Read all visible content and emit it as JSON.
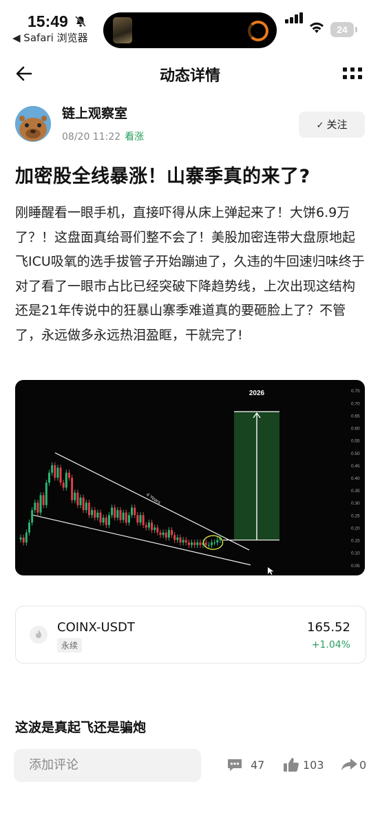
{
  "status_bar": {
    "time": "15:49",
    "back_app": "◀ Safari 浏览器",
    "battery": "24"
  },
  "nav": {
    "title": "动态详情"
  },
  "author": {
    "name": "链上观察室",
    "date": "08/20 11:22",
    "tag": "看涨",
    "follow_label": "关注"
  },
  "post": {
    "title": "加密股全线暴涨！山寨季真的来了?",
    "body": "刚睡醒看一眼手机，直接吓得从床上弹起来了！大饼6.9万了？！这盘面真给哥们整不会了！美股加密连带大盘原地起飞ICU吸氧的选手拔管子开始蹦迪了，久违的牛回速归味终于对了看了一眼市占比已经突破下降趋势线，上次出现这结构还是21年传说中的狂暴山寨季难道真的要砸脸上了？不管了，永远做多永远热泪盈眶，干就完了!"
  },
  "chart_data": {
    "type": "candlestick",
    "annotation_top": "2026",
    "annotation_trend": "4 Years",
    "y_ticks": [
      "0.75",
      "0.70",
      "0.65",
      "0.60",
      "0.55",
      "0.50",
      "0.45",
      "0.40",
      "0.35",
      "0.30",
      "0.25",
      "0.20",
      "0.15",
      "0.10",
      "0.05"
    ],
    "ylim": [
      0.03,
      0.77
    ],
    "projection": {
      "from": 0.15,
      "to": 0.665
    },
    "closes": [
      0.16,
      0.14,
      0.18,
      0.22,
      0.27,
      0.3,
      0.26,
      0.33,
      0.29,
      0.38,
      0.42,
      0.45,
      0.4,
      0.44,
      0.38,
      0.36,
      0.42,
      0.4,
      0.31,
      0.34,
      0.29,
      0.32,
      0.27,
      0.3,
      0.25,
      0.27,
      0.24,
      0.26,
      0.22,
      0.24,
      0.21,
      0.25,
      0.28,
      0.24,
      0.27,
      0.23,
      0.26,
      0.22,
      0.25,
      0.28,
      0.25,
      0.22,
      0.25,
      0.21,
      0.2,
      0.22,
      0.19,
      0.2,
      0.18,
      0.17,
      0.18,
      0.16,
      0.19,
      0.17,
      0.15,
      0.16,
      0.14,
      0.15,
      0.14,
      0.13,
      0.14,
      0.13,
      0.14,
      0.13,
      0.14,
      0.13,
      0.13,
      0.14,
      0.14,
      0.15,
      0.16
    ],
    "colors": {
      "up": "#2bb673",
      "down": "#e2404a",
      "projection": "#1f5a2a"
    }
  },
  "ticker": {
    "symbol": "COINX-USDT",
    "type": "永续",
    "price": "165.52",
    "change": "+1.04%"
  },
  "comments": {
    "first_preview": "这波是真起飞还是骗炮"
  },
  "bottom_bar": {
    "input_placeholder": "添加评论",
    "comment_count": "47",
    "like_count": "103",
    "share_count": "0"
  }
}
